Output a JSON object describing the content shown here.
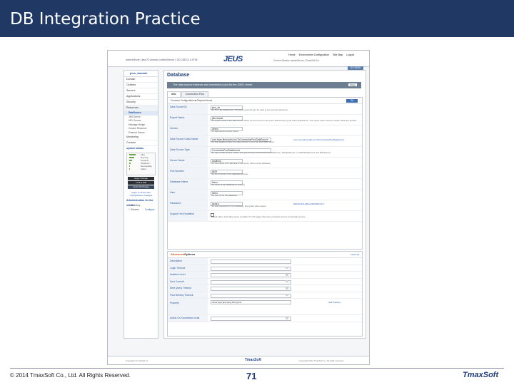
{
  "slide": {
    "title": "DB Integration Practice",
    "copyright": "© 2014 TmaxSoft Co., Ltd. All Rights Reserved.",
    "page_number": "71",
    "logo_text": "TmaxSoft",
    "header_color": "#1f3864"
  },
  "screen": {
    "topbar": {
      "product_logo": "JEUS",
      "nav": [
        "Home",
        "Environment Configuration",
        "Site Map",
        "Logout"
      ],
      "domain_text": "adminServer | jeus72-domain | adminServer | 192.168.10.1:9736",
      "sub_text": "Current Session: adminServer | TmaxSoft Co."
    },
    "go_back": "GO BACK",
    "sidebar": {
      "head": "jeus_domain",
      "items": [
        "Domain",
        "Clusters",
        "Servers",
        "Applications",
        "Security",
        "Resources"
      ],
      "resource_subitems": [
        "DataSource",
        "JMS Server",
        "URL Source",
        "Message Bridge",
        "Custom Resource",
        "External Source"
      ],
      "items2": [
        "Monitoring",
        "Console"
      ],
      "system_status_label": "system status",
      "status_rows": [
        "Alive",
        "Running",
        "Suspend",
        "Shutdown",
        "Recoverable",
        "Failed"
      ],
      "status_fill": [
        0.75,
        0.55,
        0.3,
        0.2,
        0.1,
        0.05
      ],
      "btn_apply": "Apply Change",
      "btn_lock": "Lock & Edit",
      "btn_undo": "Undo All Change",
      "link_text": "Apply to all Domain Configuration Changes",
      "admin_label": "Administration for the server",
      "check_1": "Directory",
      "check_2": "Servers",
      "check_2_link": "Configure"
    },
    "main": {
      "title": "Database",
      "info_bar": "The data source instance and connection pool for the JDBC driver.",
      "close_label": "Close",
      "tabs": [
        "Info",
        "Connection Pool"
      ],
      "toolbar": {
        "left": "Common Configuration  ■ Required Items",
        "ok": "OK"
      },
      "fields": [
        {
          "label": "Data Source ID",
          "value": "jeus_ds",
          "desc": "The ID of the datasource. This data source ID can be used to set resource reference.",
          "link": ""
        },
        {
          "label": "Export Name",
          "value": "jdbc/oracle",
          "desc": "The export name of the data source which can be used to look up the data source by the client applications. The export name must be unique within the domain.",
          "link": ""
        },
        {
          "label": "Vendor",
          "value": "others",
          "desc": "The data source vendor name.",
          "link": ""
        },
        {
          "label": "Data Source Class Name",
          "value": "com.tmax.tibero.jdbc.ext.TbConnectionPoolDataSource",
          "desc": "The fully qualified name of a data source, or you can add JDBC driver.",
          "link": "com.tmax.tibero.jdbc.ext.TbConnectionPoolDataSource"
        },
        {
          "label": "Data Source Type",
          "value": "ConnectionPoolDataSource",
          "desc": "The type of data source. Select one type among ConnectionPoolDataSource, XADataSource, LocalXADataSource and DataSource.",
          "link": ""
        },
        {
          "label": "Server Name",
          "value": "localhost",
          "desc": "The host name or IP address of the server that runs the database.",
          "link": ""
        },
        {
          "label": "Port Number",
          "value": "8629",
          "desc": "The port number of the database listener.",
          "link": ""
        },
        {
          "label": "Database Name",
          "value": "tibero",
          "desc": "The name of the database to connect.",
          "link": ""
        },
        {
          "label": "User",
          "value": "tibero",
          "desc": "The user ID for the database.",
          "link": ""
        },
        {
          "label": "Password",
          "value": "●●●●●",
          "desc": "The user password for the database. Encrypted when saved.",
          "link": "{DES}cUknLqfIEvm0kK0R9mQ=="
        },
        {
          "label": "Support Xa Emulation",
          "value": "",
          "desc": "Default: false. Sets data source emulation for XA usage when the connection pool is a local data source.",
          "link": ""
        }
      ],
      "advanced": {
        "title_prefix": "Advanced",
        "title_rest": "Options",
        "collapse": "Close All",
        "rows": [
          {
            "label": "Description",
            "value": "",
            "dd": false,
            "link": ""
          },
          {
            "label": "Login Timeout",
            "value": "",
            "dd": true,
            "link": ""
          },
          {
            "label": "Isolation Level",
            "value": "",
            "dd": true,
            "link": ""
          },
          {
            "label": "Auto Commit",
            "value": "",
            "dd": true,
            "link": ""
          },
          {
            "label": "Stmt Query Timeout",
            "value": "",
            "dd": true,
            "link": ""
          },
          {
            "label": "Pool Destroy Timeout",
            "value": "",
            "dd": true,
            "link": ""
          },
          {
            "label": "Property",
            "value": "driverType:java.lang.String:thin",
            "dd": false,
            "link": "Add Property"
          },
          {
            "label": "Action On Connection Leak",
            "value": "",
            "dd": true,
            "link": ""
          }
        ]
      }
    },
    "footer": {
      "left": "Copyright | TmaxSoft Co.",
      "brand": "TmaxSoft",
      "right": "Copyright 2014 TmaxSoft Co. All rights reserved"
    }
  }
}
